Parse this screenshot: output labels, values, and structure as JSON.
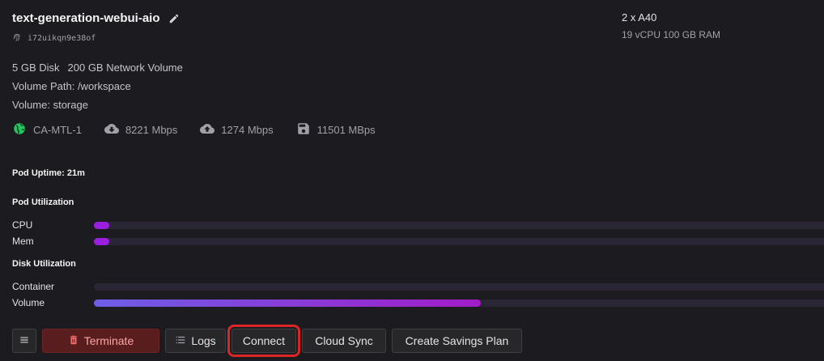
{
  "pod": {
    "name": "text-generation-webui-aio",
    "id": "i72uikqn9e38of",
    "gpu": "2 x A40",
    "specs": "19 vCPU 100 GB RAM"
  },
  "storage": {
    "disk": "5 GB Disk",
    "network_volume": "200 GB Network Volume",
    "volume_path": "Volume Path: /workspace",
    "volume_name": "Volume: storage"
  },
  "network": {
    "region": "CA-MTL-1",
    "download": "8221 Mbps",
    "upload": "1274 Mbps",
    "disk_speed": "11501 MBps"
  },
  "uptime": "Pod Uptime: 21m",
  "pod_utilization": {
    "title": "Pod Utilization",
    "cpu_label": "CPU",
    "cpu_fraction": 0.02,
    "mem_label": "Mem",
    "mem_fraction": 0.02
  },
  "disk_utilization": {
    "title": "Disk Utilization",
    "container_label": "Container",
    "container_fraction": 0.0,
    "volume_label": "Volume",
    "volume_fraction": 0.53
  },
  "actions": {
    "terminate": "Terminate",
    "logs": "Logs",
    "connect": "Connect",
    "cloud_sync": "Cloud Sync",
    "savings_plan": "Create Savings Plan"
  },
  "colors": {
    "region_icon": "#22c55e",
    "bar_fill": "#9b1fe0",
    "volume_gradient_start": "#6d5ee8",
    "volume_gradient_end": "#a21cc9",
    "highlight": "#dc2626"
  }
}
